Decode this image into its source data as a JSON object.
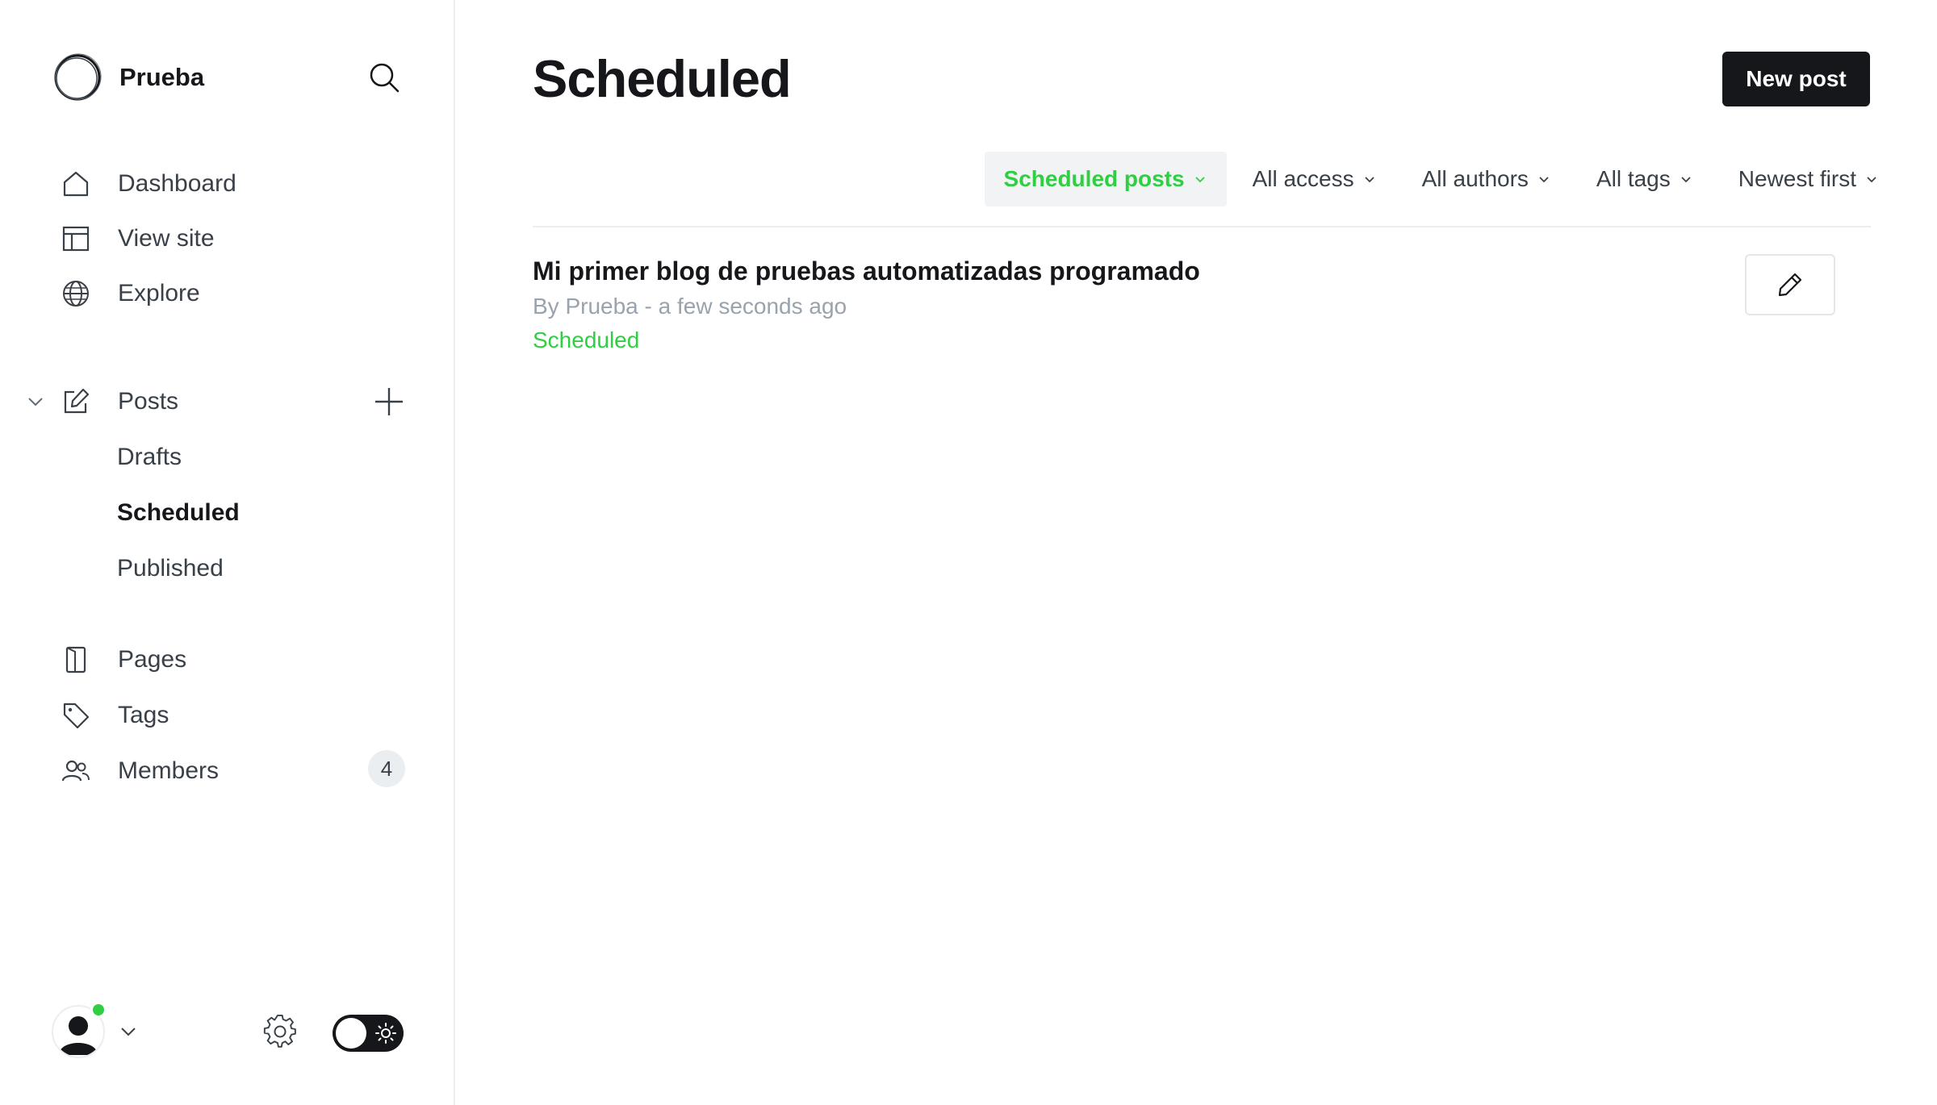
{
  "brand": {
    "name": "Prueba",
    "logo_icon": "circle-logo-icon"
  },
  "sidebar": {
    "search_icon": "search-icon",
    "nav_items": [
      {
        "label": "Dashboard",
        "icon": "home-icon"
      },
      {
        "label": "View site",
        "icon": "layout-icon"
      },
      {
        "label": "Explore",
        "icon": "globe-icon"
      }
    ],
    "posts": {
      "label": "Posts",
      "icon": "edit-icon",
      "sub_items": [
        {
          "label": "Drafts"
        },
        {
          "label": "Scheduled",
          "active": true
        },
        {
          "label": "Published"
        }
      ]
    },
    "lower_items": [
      {
        "label": "Pages",
        "icon": "page-icon"
      },
      {
        "label": "Tags",
        "icon": "tag-icon"
      },
      {
        "label": "Members",
        "icon": "members-icon",
        "badge": "4"
      }
    ],
    "footer": {
      "avatar_icon": "user-avatar-icon",
      "settings_icon": "gear-icon",
      "theme_icon": "sun-icon",
      "online_color": "#30cf43"
    }
  },
  "main": {
    "title": "Scheduled",
    "new_post_label": "New post",
    "filters": [
      {
        "label": "Scheduled posts",
        "active": true
      },
      {
        "label": "All access"
      },
      {
        "label": "All authors"
      },
      {
        "label": "All tags"
      },
      {
        "label": "Newest first"
      }
    ],
    "posts": [
      {
        "title": "Mi primer blog de pruebas automatizadas programado",
        "meta": "By Prueba - a few seconds ago",
        "status": "Scheduled"
      }
    ]
  },
  "colors": {
    "accent_green": "#30cf43",
    "primary_dark": "#15171a",
    "muted_text": "#99a3ad"
  }
}
